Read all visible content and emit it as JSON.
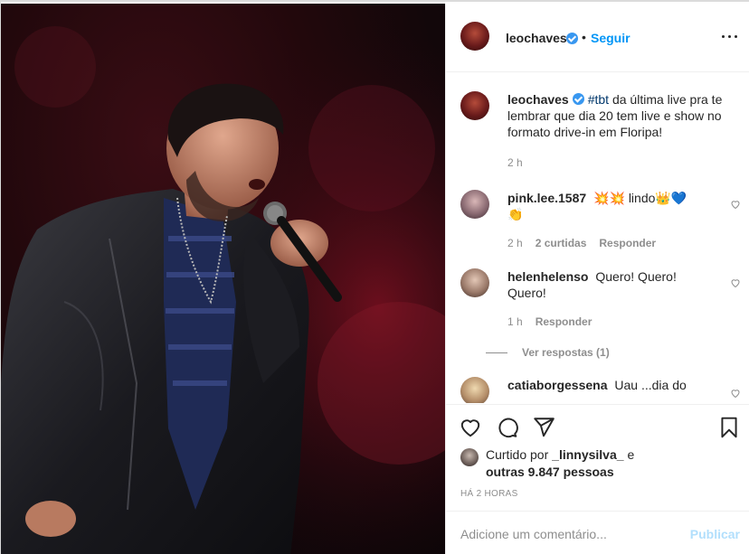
{
  "post": {
    "author": "leochaves",
    "follow_label": "Seguir",
    "separator": "•",
    "caption_hashtag": "#tbt",
    "caption_text": "da última live pra te lembrar que dia 20 tem live e show no formato drive-in em Floripa!",
    "caption_time": "2 h"
  },
  "comments": [
    {
      "username": "pink.lee.1587",
      "text": "💥💥 lindo👑💙👏",
      "time": "2 h",
      "likes": "2 curtidas",
      "reply_label": "Responder"
    },
    {
      "username": "helenhelenso",
      "text": "Quero! Quero! Quero!",
      "time": "1 h",
      "reply_label": "Responder",
      "view_replies": "Ver respostas (1)"
    },
    {
      "username": "catiaborgessena",
      "text": "Uau ...dia do"
    }
  ],
  "likes": {
    "prefix": "Curtido por",
    "user": "_linnysilva_",
    "conjunction": "e",
    "others": "outras 9.847 pessoas"
  },
  "timestamp": "Há 2 horas",
  "composer": {
    "placeholder": "Adicione um comentário...",
    "publish_label": "Publicar"
  },
  "icons": [
    "more-options-icon",
    "verified-icon",
    "heart-icon",
    "comment-icon",
    "share-icon",
    "bookmark-icon"
  ],
  "colors": {
    "accent": "#0095f6",
    "verified": "#3897f0",
    "muted": "#8e8e8e",
    "publish_disabled": "#b2dffc"
  }
}
